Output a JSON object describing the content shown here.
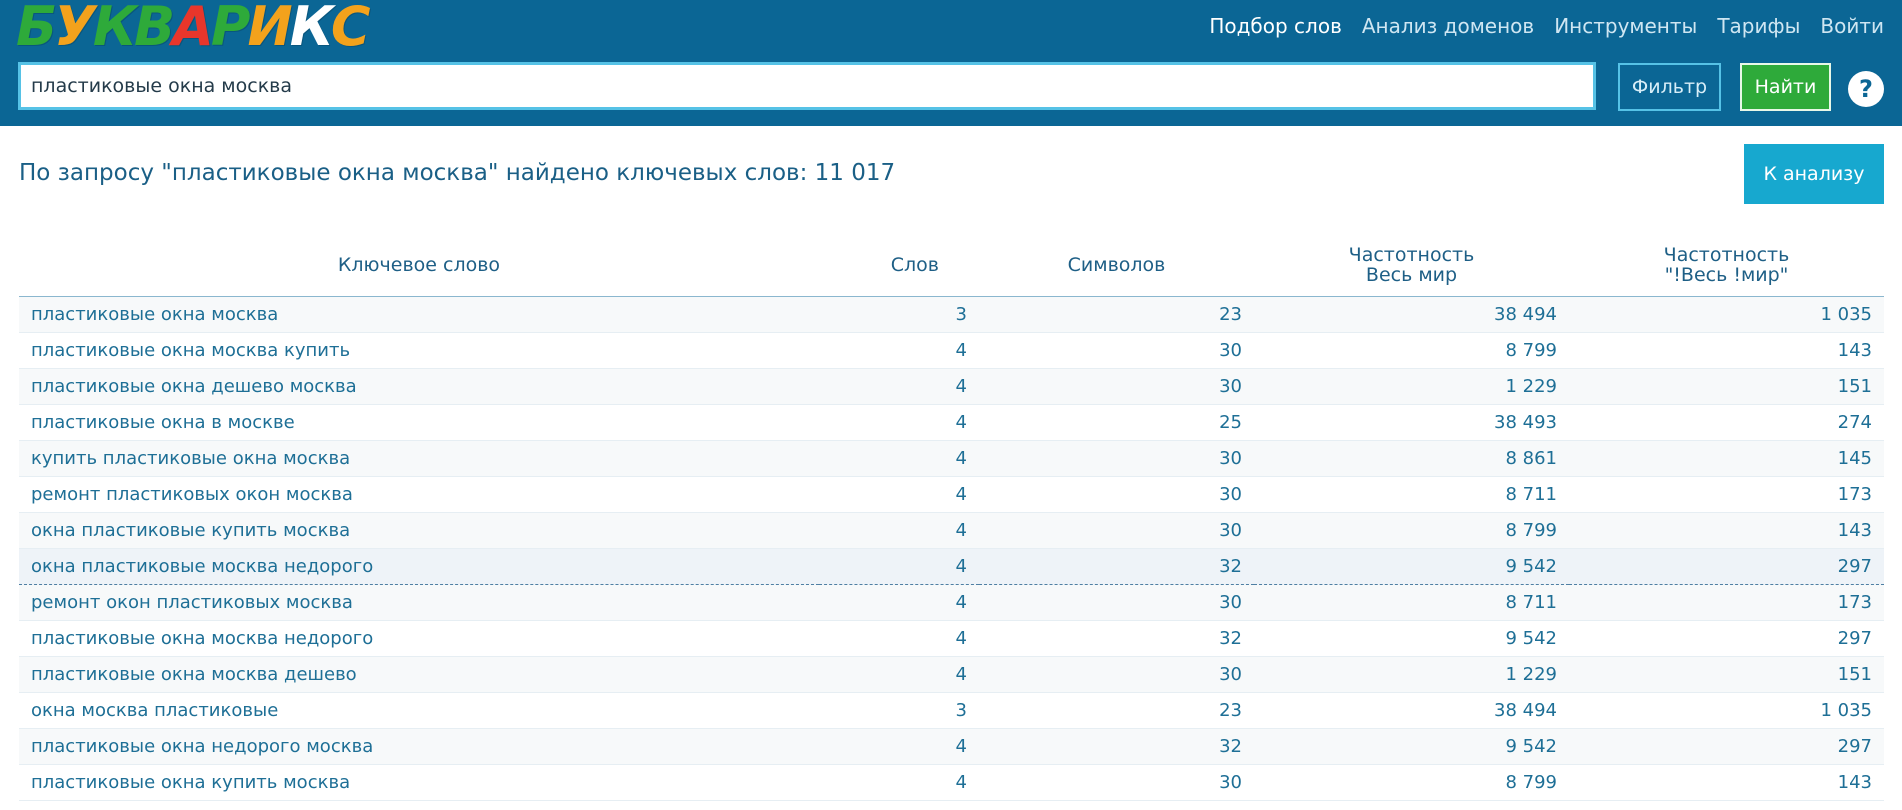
{
  "brand": {
    "letters": [
      {
        "char": "Б",
        "color": "#2eaa3a"
      },
      {
        "char": "У",
        "color": "#f3a21c"
      },
      {
        "char": "К",
        "color": "#2eaa3a"
      },
      {
        "char": "В",
        "color": "#2eaa3a"
      },
      {
        "char": "А",
        "color": "#e8362b"
      },
      {
        "char": "Р",
        "color": "#2eaa3a"
      },
      {
        "char": "И",
        "color": "#f3a21c"
      },
      {
        "char": "К",
        "color": "#ffffff"
      },
      {
        "char": "С",
        "color": "#f3a21c"
      }
    ]
  },
  "nav": {
    "items": [
      {
        "label": "Подбор слов",
        "active": true
      },
      {
        "label": "Анализ доменов",
        "active": false
      },
      {
        "label": "Инструменты",
        "active": false
      },
      {
        "label": "Тарифы",
        "active": false
      },
      {
        "label": "Войти",
        "active": false
      }
    ]
  },
  "search": {
    "value": "пластиковые окна москва",
    "filter_label": "Фильтр",
    "find_label": "Найти",
    "help_symbol": "?"
  },
  "results": {
    "title": "По запросу \"пластиковые окна москва\" найдено ключевых слов: 11 017",
    "analysis_button": "К анализу"
  },
  "table": {
    "headers": {
      "keyword": "Ключевое слово",
      "words": "Слов",
      "chars": "Символов",
      "freq_world_line1": "Частотность",
      "freq_world_line2": "Весь мир",
      "freq_exact_line1": "Частотность",
      "freq_exact_line2": "\"!Весь !мир\""
    },
    "rows": [
      {
        "keyword": "пластиковые окна москва",
        "words": "3",
        "chars": "23",
        "freq": "38 494",
        "exact": "1 035"
      },
      {
        "keyword": "пластиковые окна москва купить",
        "words": "4",
        "chars": "30",
        "freq": "8 799",
        "exact": "143"
      },
      {
        "keyword": "пластиковые окна дешево москва",
        "words": "4",
        "chars": "30",
        "freq": "1 229",
        "exact": "151"
      },
      {
        "keyword": "пластиковые окна в москве",
        "words": "4",
        "chars": "25",
        "freq": "38 493",
        "exact": "274"
      },
      {
        "keyword": "купить пластиковые окна москва",
        "words": "4",
        "chars": "30",
        "freq": "8 861",
        "exact": "145"
      },
      {
        "keyword": "ремонт пластиковых окон москва",
        "words": "4",
        "chars": "30",
        "freq": "8 711",
        "exact": "173"
      },
      {
        "keyword": "окна пластиковые купить москва",
        "words": "4",
        "chars": "30",
        "freq": "8 799",
        "exact": "143"
      },
      {
        "keyword": "окна пластиковые москва недорого",
        "words": "4",
        "chars": "32",
        "freq": "9 542",
        "exact": "297"
      },
      {
        "keyword": "ремонт окон пластиковых москва",
        "words": "4",
        "chars": "30",
        "freq": "8 711",
        "exact": "173"
      },
      {
        "keyword": "пластиковые окна москва недорого",
        "words": "4",
        "chars": "32",
        "freq": "9 542",
        "exact": "297"
      },
      {
        "keyword": "пластиковые окна москва дешево",
        "words": "4",
        "chars": "30",
        "freq": "1 229",
        "exact": "151"
      },
      {
        "keyword": "окна москва пластиковые",
        "words": "3",
        "chars": "23",
        "freq": "38 494",
        "exact": "1 035"
      },
      {
        "keyword": "пластиковые окна недорого москва",
        "words": "4",
        "chars": "32",
        "freq": "9 542",
        "exact": "297"
      },
      {
        "keyword": "пластиковые окна купить москва",
        "words": "4",
        "chars": "30",
        "freq": "8 799",
        "exact": "143"
      }
    ],
    "highlighted_row": 7
  }
}
